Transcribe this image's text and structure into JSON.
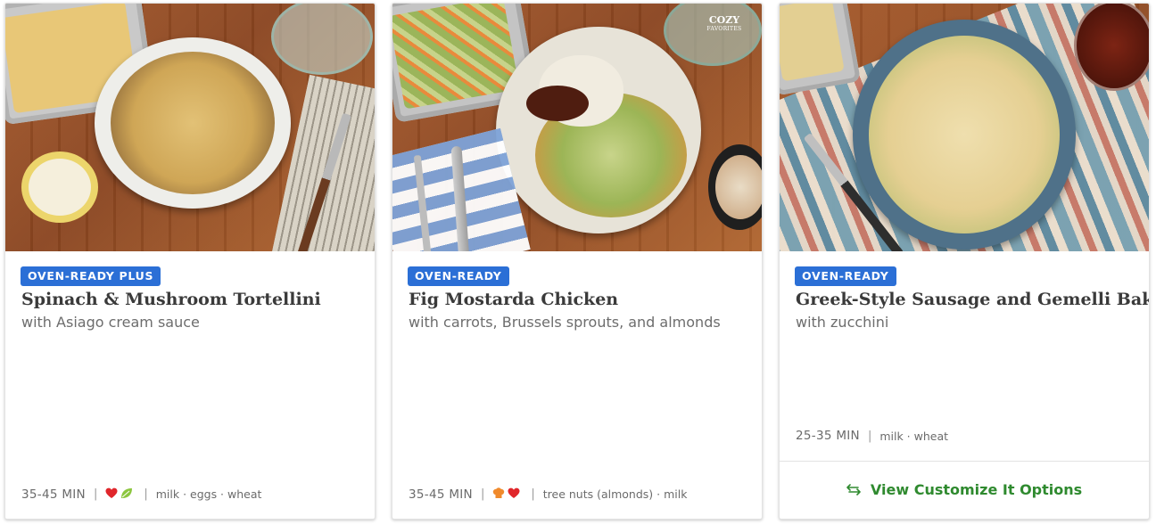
{
  "cards": [
    {
      "badge": "OVEN-READY PLUS",
      "title": "Spinach & Mushroom Tortellini",
      "subtitle": "with Asiago cream sauce",
      "time": "35-45 MIN",
      "icons": [
        "heart-icon",
        "leaf-icon"
      ],
      "allergens": "milk · eggs · wheat"
    },
    {
      "badge": "OVEN-READY",
      "title": "Fig Mostarda Chicken",
      "subtitle": "with carrots, Brussels sprouts, and almonds",
      "time": "35-45 MIN",
      "icons": [
        "chef-hat-icon",
        "heart-icon"
      ],
      "allergens": "tree nuts (almonds) · milk",
      "photo_stamp": "COZY FAVORITES"
    },
    {
      "badge": "OVEN-READY",
      "title": "Greek-Style Sausage and Gemelli Bake",
      "subtitle": "with zucchini",
      "time": "25-35 MIN",
      "allergens": "milk · wheat",
      "customize_label": "View Customize It Options"
    }
  ],
  "colors": {
    "badge": "#2b6fd6",
    "customize_link": "#2f8a2f",
    "heart": "#e0262b",
    "leaf": "#8cc63f",
    "chef_hat": "#f08a2c"
  }
}
